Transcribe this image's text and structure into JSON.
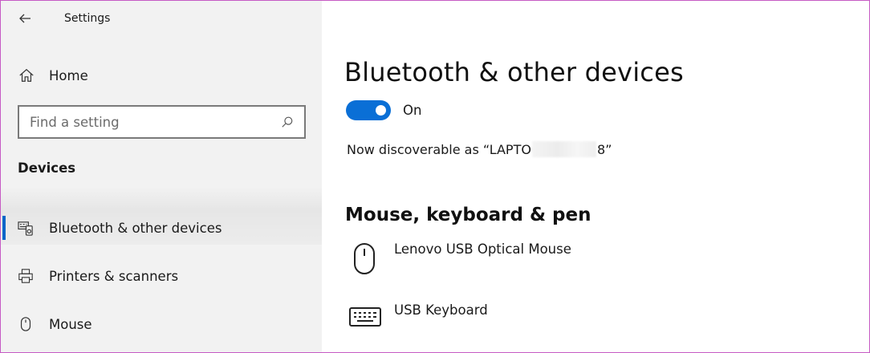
{
  "app": {
    "title": "Settings",
    "back_icon": "back-arrow-icon"
  },
  "sidebar": {
    "home": {
      "label": "Home",
      "icon": "home-icon"
    },
    "search": {
      "placeholder": "Find a setting",
      "icon": "search-icon"
    },
    "section": "Devices",
    "items": [
      {
        "label": "Bluetooth & other devices",
        "icon": "bluetooth-devices-icon",
        "active": true
      },
      {
        "label": "Printers & scanners",
        "icon": "printer-icon",
        "active": false
      },
      {
        "label": "Mouse",
        "icon": "mouse-icon",
        "active": false
      }
    ]
  },
  "main": {
    "title": "Bluetooth & other devices",
    "bluetooth_toggle": {
      "state": "On",
      "on": true
    },
    "discoverable": {
      "prefix": "Now discoverable as “LAPTO",
      "suffix": "8”"
    },
    "mouse_section": {
      "title": "Mouse, keyboard & pen",
      "devices": [
        {
          "name": "Lenovo USB Optical Mouse",
          "icon": "mouse-icon"
        },
        {
          "name": "USB Keyboard",
          "icon": "keyboard-icon"
        }
      ]
    }
  },
  "colors": {
    "accent": "#0a6fd6",
    "sidebar_bg": "#f2f2f2",
    "frame_border": "#c65bc4"
  }
}
